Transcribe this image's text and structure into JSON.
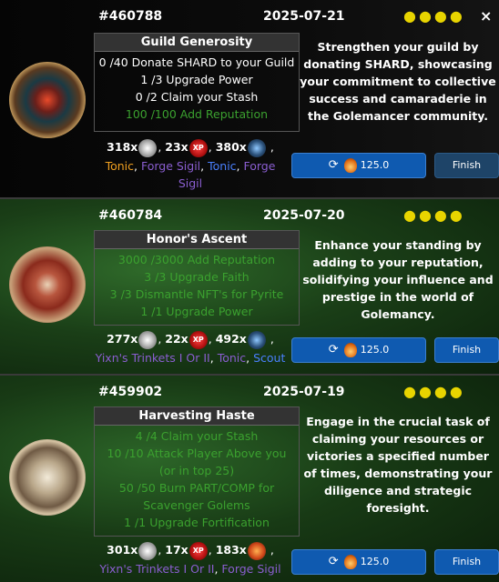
{
  "colors": {
    "done": "#3ba12f",
    "star": "#e8d400",
    "button": "#0f5ab0",
    "finish_dark": "#1e4468",
    "reward_orange": "#f0a020",
    "reward_purple": "#8a5ed0",
    "reward_blue": "#4a80ff"
  },
  "cards": [
    {
      "id": "#460788",
      "date": "2025-07-21",
      "stars": "●●●●",
      "close": "×",
      "title": "Guild Generosity",
      "tasks": [
        {
          "text": "0 /40 Donate SHARD to your Guild",
          "done": false
        },
        {
          "text": "1 /3 Upgrade Power",
          "done": false
        },
        {
          "text": "0 /2 Claim your Stash",
          "done": false
        },
        {
          "text": "100 /100 Add Reputation",
          "done": true
        }
      ],
      "description": "Strengthen your guild by donating SHARD, showcasing your commitment to collective success and camaraderie in the Golemancer community.",
      "reward_counts": {
        "a": "318x",
        "b": "23x",
        "c": "380x"
      },
      "reward_icons": [
        "star-shard-icon",
        "xp-icon",
        "golem-icon"
      ],
      "reward_names": [
        "Tonic",
        "Forge Sigil",
        "Tonic",
        "Forge Sigil"
      ],
      "cost": "125.0",
      "finish": "Finish"
    },
    {
      "id": "#460784",
      "date": "2025-07-20",
      "stars": "●●●●",
      "title": "Honor's Ascent",
      "tasks": [
        {
          "text": "3000 /3000 Add Reputation",
          "done": true
        },
        {
          "text": "3 /3 Upgrade Faith",
          "done": true
        },
        {
          "text": "3 /3 Dismantle NFT's for Pyrite",
          "done": true
        },
        {
          "text": "1 /1 Upgrade Power",
          "done": true
        }
      ],
      "description": "Enhance your standing by adding to your reputation, solidifying your influence and prestige in the world of Golemancy.",
      "reward_counts": {
        "a": "277x",
        "b": "22x",
        "c": "492x"
      },
      "reward_icons": [
        "star-shard-icon",
        "xp-icon",
        "golem-icon"
      ],
      "reward_names": [
        "Yixn's Trinkets I Or II",
        "Tonic",
        "Scout"
      ],
      "cost": "125.0",
      "finish": "Finish"
    },
    {
      "id": "#459902",
      "date": "2025-07-19",
      "stars": "●●●●",
      "title": "Harvesting Haste",
      "tasks": [
        {
          "text": "4 /4 Claim your Stash",
          "done": true
        },
        {
          "text": "10 /10 Attack Player Above you (or in top 25)",
          "done": true
        },
        {
          "text": "50 /50 Burn PART/COMP for Scavenger Golems",
          "done": true
        },
        {
          "text": "1 /1 Upgrade Fortification",
          "done": true
        }
      ],
      "description": "Engage in the crucial task of claiming your resources or victories a specified number of times, demonstrating your diligence and strategic foresight.",
      "reward_counts": {
        "a": "301x",
        "b": "17x",
        "c": "183x"
      },
      "reward_icons": [
        "star-shard-icon",
        "xp-icon",
        "fire-icon"
      ],
      "reward_names": [
        "Yixn's Trinkets I Or II",
        "Forge Sigil"
      ],
      "cost": "125.0",
      "finish": "Finish"
    }
  ],
  "xp_label": "XP"
}
